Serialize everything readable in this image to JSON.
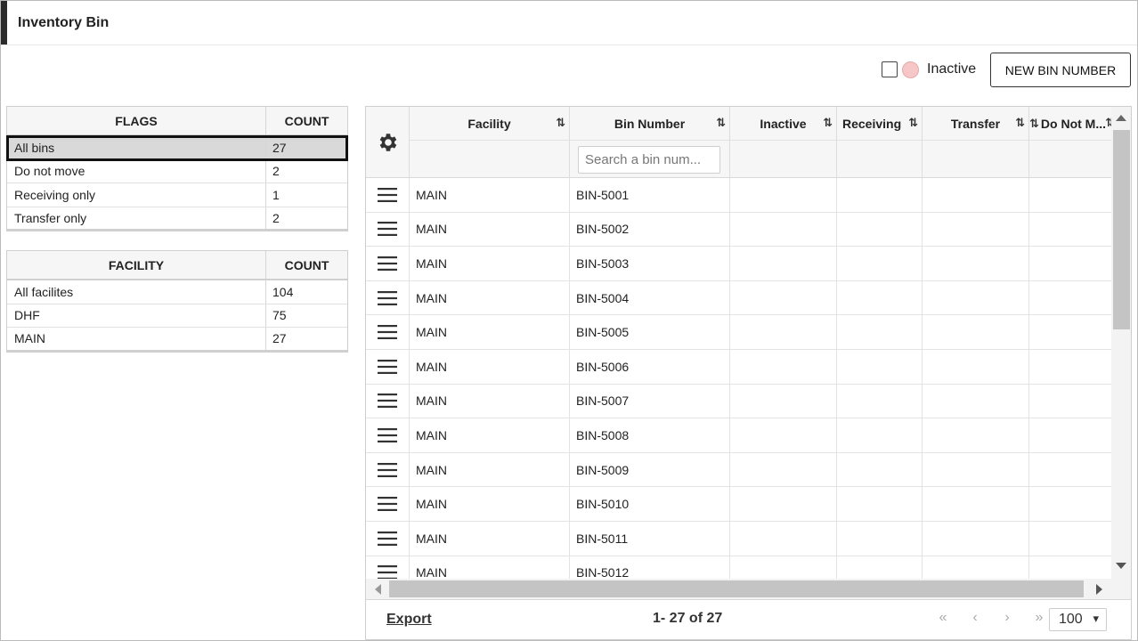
{
  "window": {
    "title": "Inventory Bin"
  },
  "toolbar": {
    "inactive_label": "Inactive",
    "new_bin_label": "NEW BIN NUMBER"
  },
  "flags_table": {
    "col1": "FLAGS",
    "col2": "COUNT",
    "rows": [
      {
        "label": "All bins",
        "count": "27",
        "selected": true
      },
      {
        "label": "Do not move",
        "count": "2"
      },
      {
        "label": "Receiving only",
        "count": "1"
      },
      {
        "label": "Transfer only",
        "count": "2"
      }
    ]
  },
  "facility_table": {
    "col1": "FACILITY",
    "col2": "COUNT",
    "rows": [
      {
        "label": "All facilites",
        "count": "104"
      },
      {
        "label": "DHF",
        "count": "75"
      },
      {
        "label": "MAIN",
        "count": "27"
      }
    ]
  },
  "grid": {
    "columns": {
      "facility": "Facility",
      "bin_number": "Bin Number",
      "inactive": "Inactive",
      "receiving": "Receiving",
      "transfer": "Transfer",
      "do_not_move": "Do Not M..."
    },
    "search_placeholder": "Search a bin num...",
    "rows": [
      {
        "facility": "MAIN",
        "bin": "BIN-5001"
      },
      {
        "facility": "MAIN",
        "bin": "BIN-5002"
      },
      {
        "facility": "MAIN",
        "bin": "BIN-5003"
      },
      {
        "facility": "MAIN",
        "bin": "BIN-5004"
      },
      {
        "facility": "MAIN",
        "bin": "BIN-5005"
      },
      {
        "facility": "MAIN",
        "bin": "BIN-5006"
      },
      {
        "facility": "MAIN",
        "bin": "BIN-5007"
      },
      {
        "facility": "MAIN",
        "bin": "BIN-5008"
      },
      {
        "facility": "MAIN",
        "bin": "BIN-5009"
      },
      {
        "facility": "MAIN",
        "bin": "BIN-5010"
      },
      {
        "facility": "MAIN",
        "bin": "BIN-5011"
      },
      {
        "facility": "MAIN",
        "bin": "BIN-5012"
      }
    ]
  },
  "footer": {
    "export_label": "Export",
    "range_text": "1- 27 of 27",
    "page_size": "100"
  },
  "icons": {
    "gear": "gear-icon",
    "menu": "hamburger-icon",
    "sort": "sort-icon"
  },
  "colors": {
    "inactive_dot": "#f7c6c6",
    "selected_row": "#d9d9d9"
  }
}
